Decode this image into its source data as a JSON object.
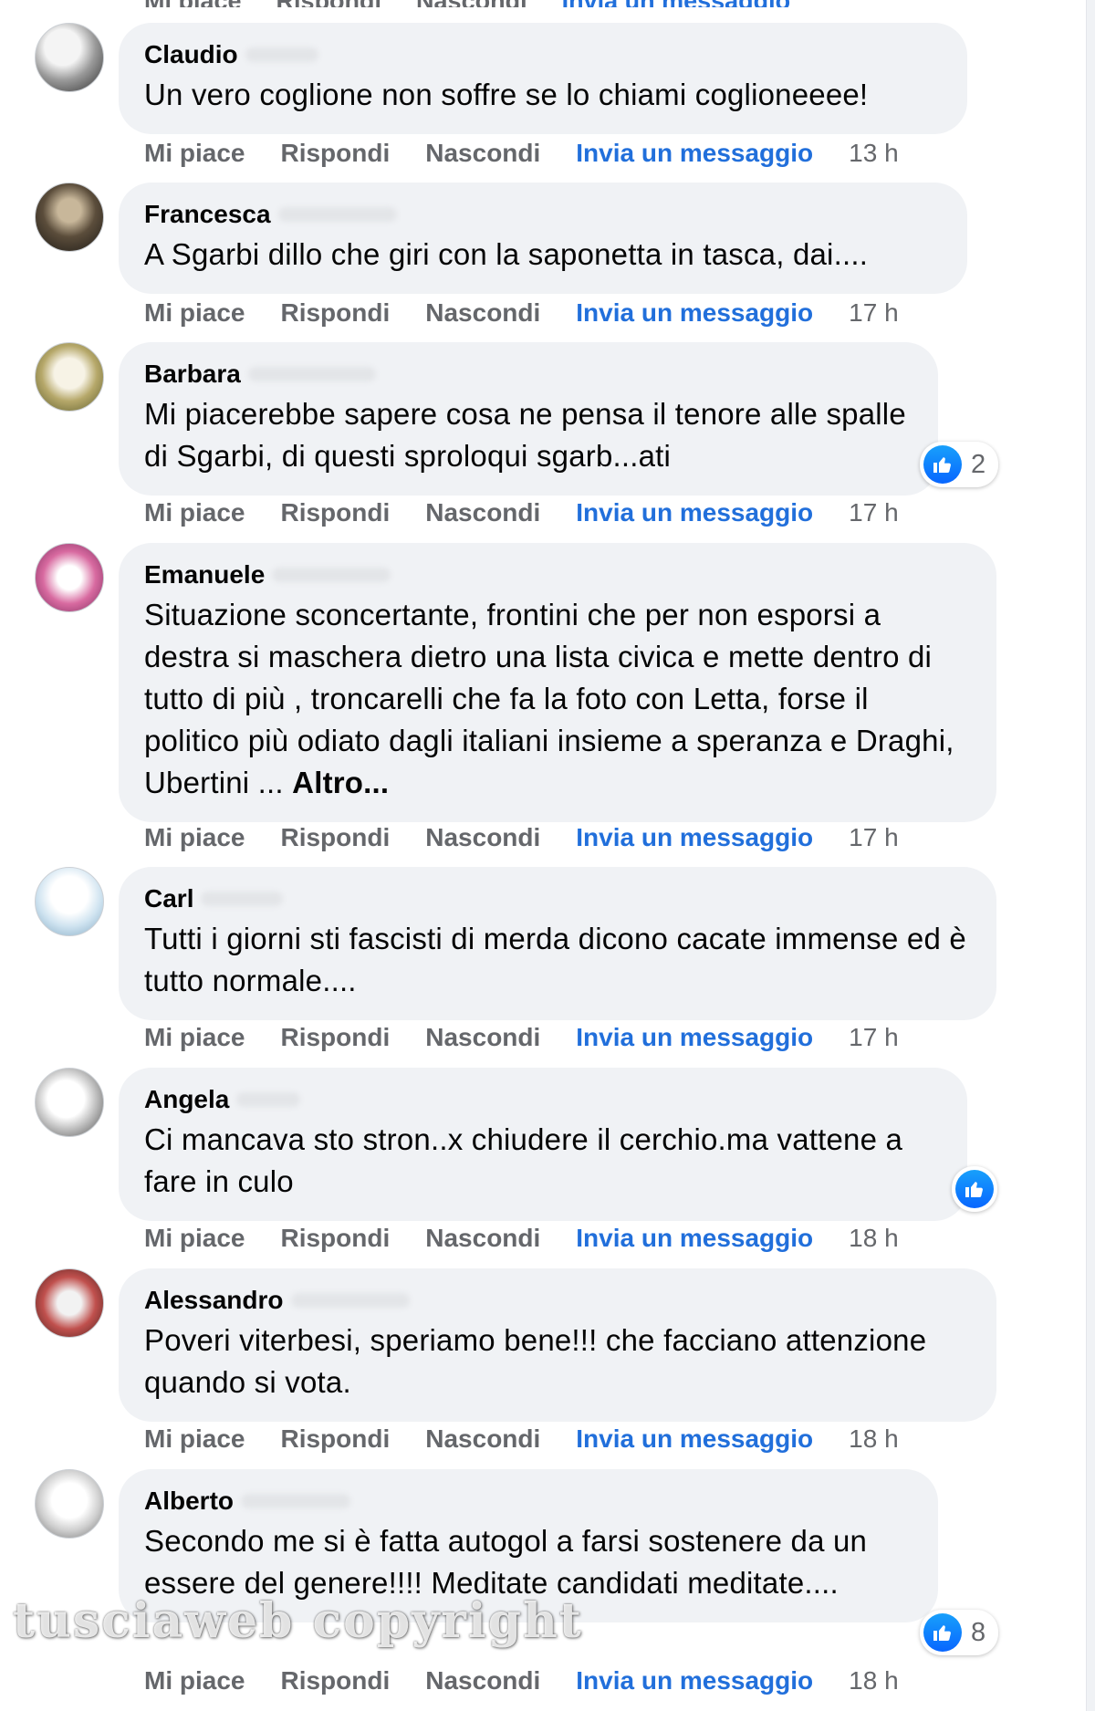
{
  "actions": {
    "like": "Mi piace",
    "reply": "Rispondi",
    "hide": "Nascondi",
    "message": "Invia un messaggio"
  },
  "comments": [
    {
      "author": "Claudio",
      "text": "Un vero coglione non soffre se lo chiami coglioneeee!",
      "time": "13 h"
    },
    {
      "author": "Francesca",
      "text": "A Sgarbi dillo che giri con la saponetta in tasca, dai....",
      "time": "17 h"
    },
    {
      "author": "Barbara",
      "text": "Mi piacerebbe sapere cosa ne pensa il tenore alle spalle di Sgarbi, di questi sproloqui sgarb...ati",
      "time": "17 h",
      "reactions": "2"
    },
    {
      "author": "Emanuele",
      "text": "Situazione sconcertante, frontini che per non esporsi a destra si maschera dietro una lista civica e mette dentro di tutto di più , troncarelli che fa la foto con Letta, forse il politico più odiato dagli italiani insieme a speranza e Draghi, Ubertini ...",
      "more": "Altro...",
      "time": "17 h"
    },
    {
      "author": "Carl",
      "text": "Tutti i giorni sti fascisti di merda dicono cacate immense ed è tutto normale....",
      "time": "17 h"
    },
    {
      "author": "Angela",
      "text": "Ci mancava sto stron..x chiudere il cerchio.ma vattene a fare in culo",
      "time": "18 h"
    },
    {
      "author": "Alessandro",
      "text": "Poveri viterbesi, speriamo bene!!! che facciano attenzione quando si vota.",
      "time": "18 h"
    },
    {
      "author": "Alberto",
      "text": "Secondo me si è fatta autogol a farsi sostenere da un essere del genere!!!! Meditate candidati meditate....",
      "time": "18 h",
      "reactions": "8"
    }
  ],
  "watermark": "tusciaweb copyright",
  "colors": {
    "bubble": "#f0f2f5",
    "link": "#216fdb",
    "meta": "#65676b",
    "like": "#0866ff"
  },
  "icons": [
    "like-reaction-icon"
  ]
}
